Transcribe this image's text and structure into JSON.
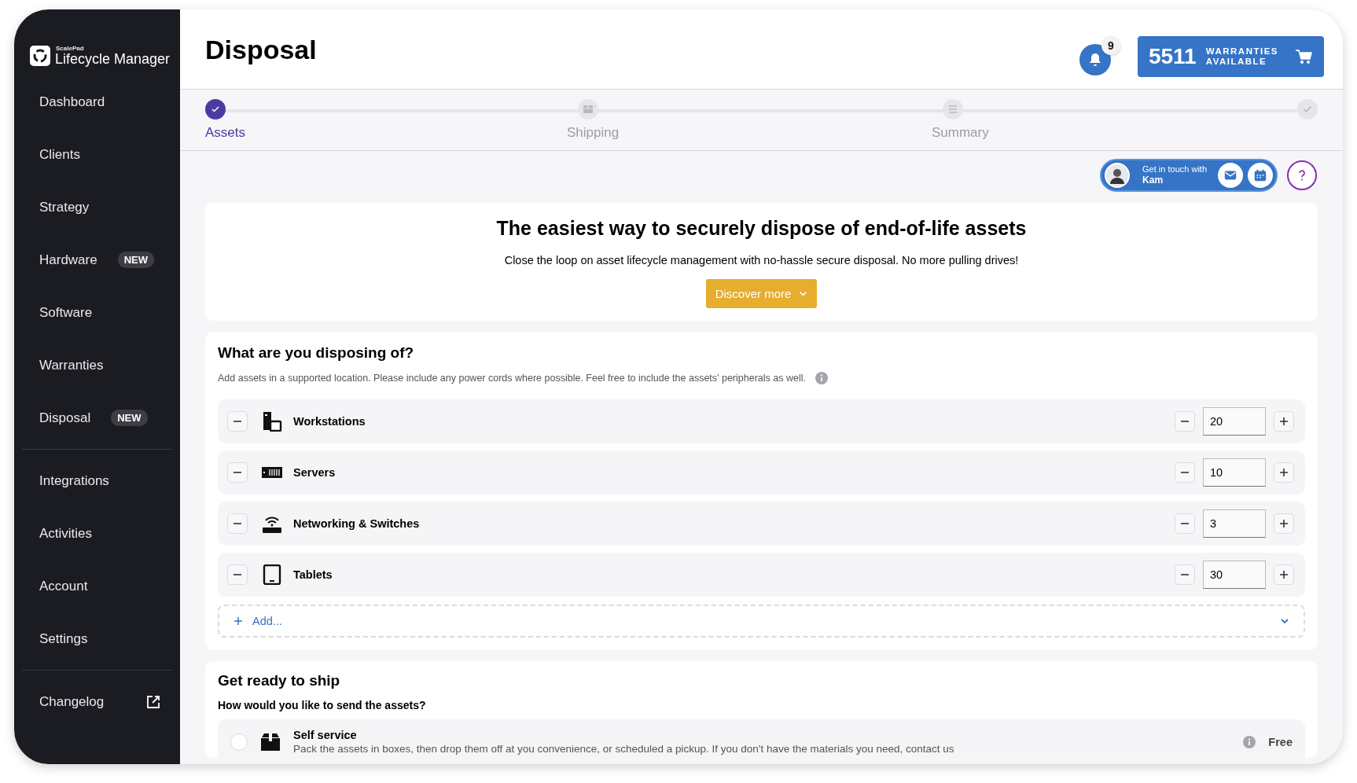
{
  "brand": {
    "company": "ScalePad",
    "product": "Lifecycle Manager"
  },
  "sidebar": {
    "sections": [
      [
        {
          "label": "Dashboard",
          "kind": "link"
        },
        {
          "label": "Clients",
          "kind": "link"
        },
        {
          "label": "Strategy",
          "kind": "link"
        },
        {
          "label": "Hardware",
          "kind": "link",
          "badge": "NEW"
        },
        {
          "label": "Software",
          "kind": "link"
        },
        {
          "label": "Warranties",
          "kind": "link"
        },
        {
          "label": "Disposal",
          "kind": "link",
          "badge": "NEW"
        }
      ],
      [
        {
          "label": "Integrations",
          "kind": "link"
        },
        {
          "label": "Activities",
          "kind": "link"
        },
        {
          "label": "Account",
          "kind": "link"
        },
        {
          "label": "Settings",
          "kind": "link"
        }
      ],
      [
        {
          "label": "Changelog",
          "kind": "external"
        }
      ]
    ]
  },
  "page": {
    "title": "Disposal"
  },
  "notifications": {
    "count": "9"
  },
  "warranties": {
    "count": "5511",
    "label": "WARRANTIES AVAILABLE"
  },
  "stepper": [
    {
      "label": "Assets",
      "selected": true
    },
    {
      "label": "Shipping",
      "selected": false
    },
    {
      "label": "Summary",
      "selected": false
    }
  ],
  "contact": {
    "prompt": "Get in touch with",
    "name": "Kam"
  },
  "hero": {
    "title": "The easiest way to securely dispose of end-of-life assets",
    "text": "Close the loop on asset lifecycle management with no-hassle secure disposal. No more pulling drives!",
    "button": "Discover more"
  },
  "assets": {
    "title": "What are you disposing of?",
    "hint": "Add assets in a supported location. Please include any power cords where possible. Feel free to include the assets' peripherals as well.",
    "rows": [
      {
        "kind": "workstation",
        "label": "Workstations",
        "value": "20"
      },
      {
        "kind": "server",
        "label": "Servers",
        "value": "10"
      },
      {
        "kind": "network",
        "label": "Networking & Switches",
        "value": "3"
      },
      {
        "kind": "tablet",
        "label": "Tablets",
        "value": "30"
      }
    ],
    "add": "Add..."
  },
  "shipping": {
    "title": "Get ready to ship",
    "question": "How would you like to send the assets?",
    "options": [
      {
        "title": "Self service",
        "text": "Pack the assets in boxes, then drop them off at you convenience, or scheduled a pickup. If you don't have the materials you need, contact us",
        "price": "Free",
        "selected": false
      }
    ]
  }
}
